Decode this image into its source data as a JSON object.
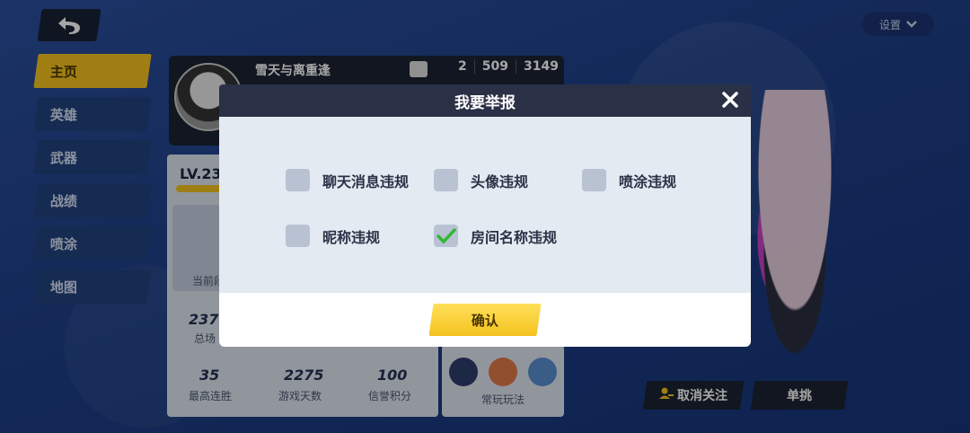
{
  "settings": {
    "label": "设置"
  },
  "sidebar": {
    "items": [
      {
        "label": "主页",
        "active": true
      },
      {
        "label": "英雄"
      },
      {
        "label": "武器"
      },
      {
        "label": "战绩"
      },
      {
        "label": "喷涂"
      },
      {
        "label": "地图"
      }
    ]
  },
  "profile": {
    "name": "雪天与离重逢",
    "stats": [
      "2",
      "509",
      "3149"
    ]
  },
  "level_panel": {
    "level": "LV.23",
    "rank_label": "当前段",
    "total_value": "237",
    "total_label": "总场",
    "max_streak_value": "35",
    "max_streak_label": "最高连胜",
    "days_value": "2275",
    "days_label": "游戏天数",
    "credit_value": "100",
    "credit_label": "信誉积分"
  },
  "modes_panel": {
    "label": "常玩玩法"
  },
  "buttons": {
    "unfollow": "取消关注",
    "duel": "单挑"
  },
  "modal": {
    "title": "我要举报",
    "options": [
      {
        "label": "聊天消息违规",
        "checked": false
      },
      {
        "label": "头像违规",
        "checked": false
      },
      {
        "label": "喷涂违规",
        "checked": false
      },
      {
        "label": "昵称违规",
        "checked": false
      },
      {
        "label": "房间名称违规",
        "checked": true
      }
    ],
    "confirm": "确认"
  },
  "colors": {
    "accent": "#f4c21f",
    "check": "#2fb82f"
  }
}
